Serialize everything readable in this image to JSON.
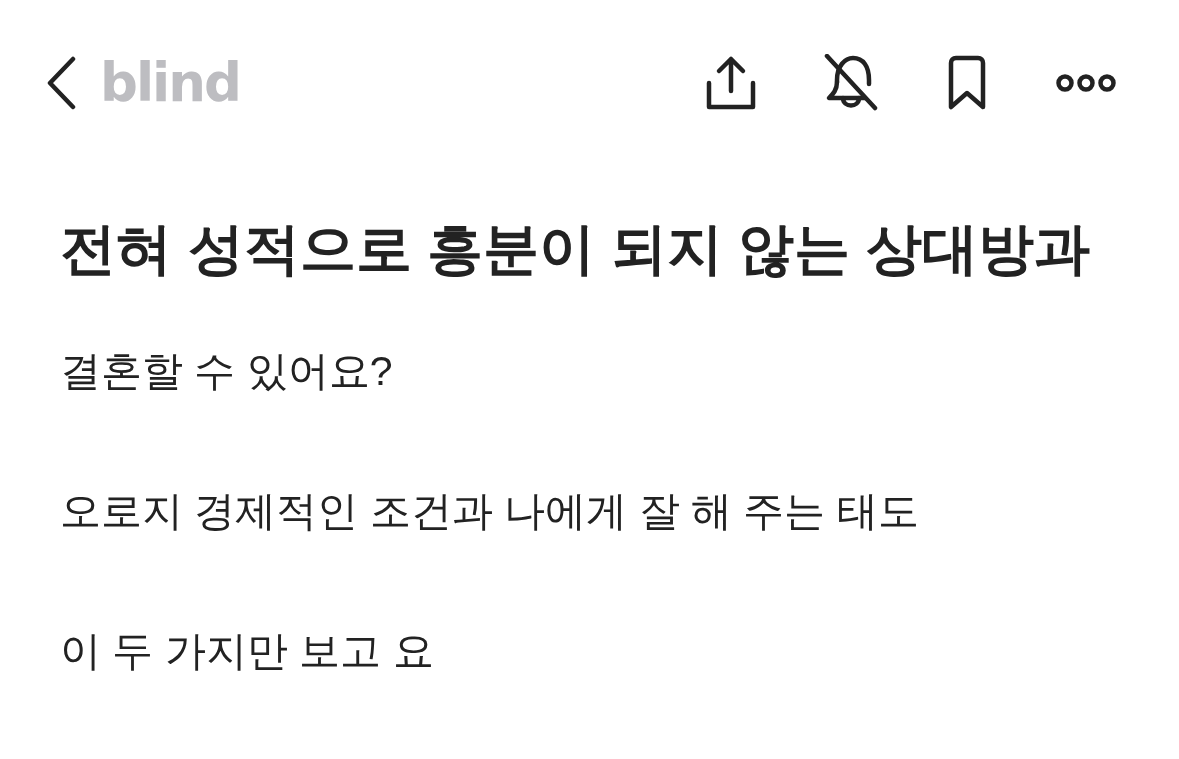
{
  "header": {
    "logo": "blind",
    "actions": [
      {
        "kind": "share"
      },
      {
        "kind": "mute"
      },
      {
        "kind": "bookmark"
      },
      {
        "kind": "more"
      }
    ]
  },
  "post": {
    "title": "전혀 성적으로 흥분이 되지 않는 상대방과",
    "paragraphs": [
      "결혼할 수 있어요?",
      "오로지 경제적인 조건과 나에게 잘 해 주는 태도",
      "이 두 가지만 보고 요"
    ]
  }
}
